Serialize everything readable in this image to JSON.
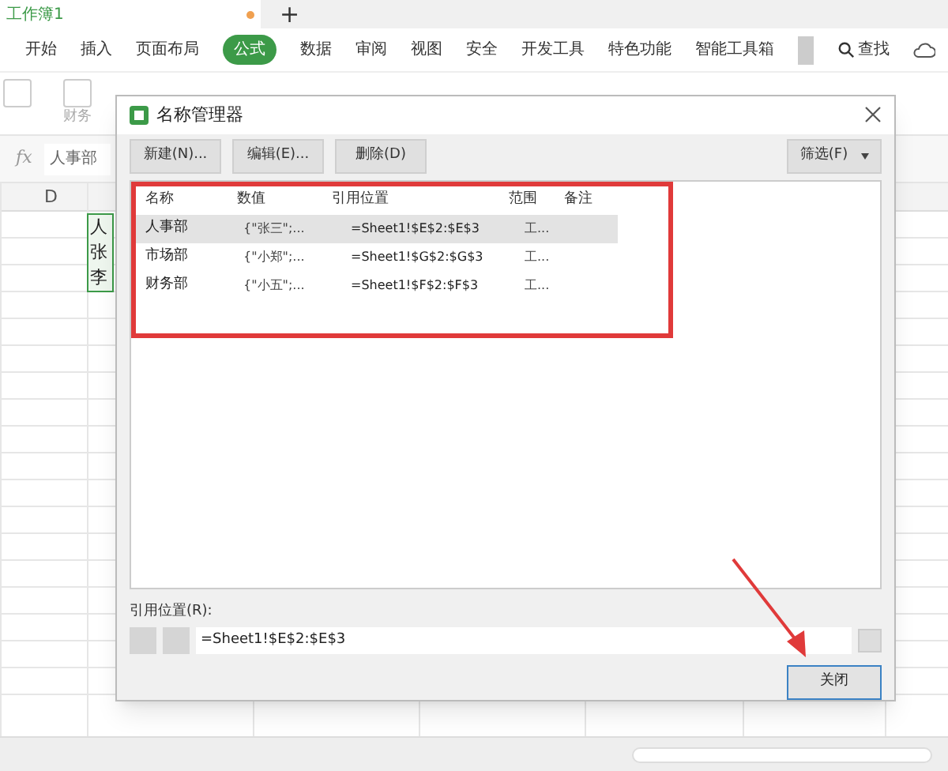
{
  "doc_tab": {
    "title": "工作簿1",
    "modified": true,
    "new_tab": "+"
  },
  "ribbon_tabs": [
    {
      "label": "开始",
      "selected": false
    },
    {
      "label": "插入",
      "selected": false
    },
    {
      "label": "页面布局",
      "selected": false
    },
    {
      "label": "公式",
      "selected": true
    },
    {
      "label": "数据",
      "selected": false
    },
    {
      "label": "审阅",
      "selected": false
    },
    {
      "label": "视图",
      "selected": false
    },
    {
      "label": "安全",
      "selected": false
    },
    {
      "label": "开发工具",
      "selected": false
    },
    {
      "label": "特色功能",
      "selected": false
    },
    {
      "label": "智能工具箱",
      "selected": false
    }
  ],
  "search": {
    "label": "查找"
  },
  "toolbar": {
    "labels": [
      "财务"
    ]
  },
  "formula_bar": {
    "fx": "fx",
    "value": "人事部"
  },
  "sheet": {
    "column": "D",
    "cells": [
      "人",
      "张",
      "李"
    ]
  },
  "dialog": {
    "title": "名称管理器",
    "buttons": [
      "新建(N)...",
      "编辑(E)...",
      "删除(D)"
    ],
    "filter": "筛选(F)",
    "columns": [
      "名称",
      "数值",
      "引用位置",
      "范围",
      "备注"
    ],
    "rows": [
      {
        "name": "人事部",
        "value": "{\"张三\";...",
        "ref": "=Sheet1!$E$2:$E$3",
        "scope": "工...",
        "selected": true
      },
      {
        "name": "市场部",
        "value": "{\"小郑\";...",
        "ref": "=Sheet1!$G$2:$G$3",
        "scope": "工...",
        "selected": false
      },
      {
        "name": "财务部",
        "value": "{\"小五\";...",
        "ref": "=Sheet1!$F$2:$F$3",
        "scope": "工...",
        "selected": false
      }
    ],
    "ref_label": "引用位置(R):",
    "ref_value": "=Sheet1!$E$2:$E$3",
    "close": "关闭"
  }
}
